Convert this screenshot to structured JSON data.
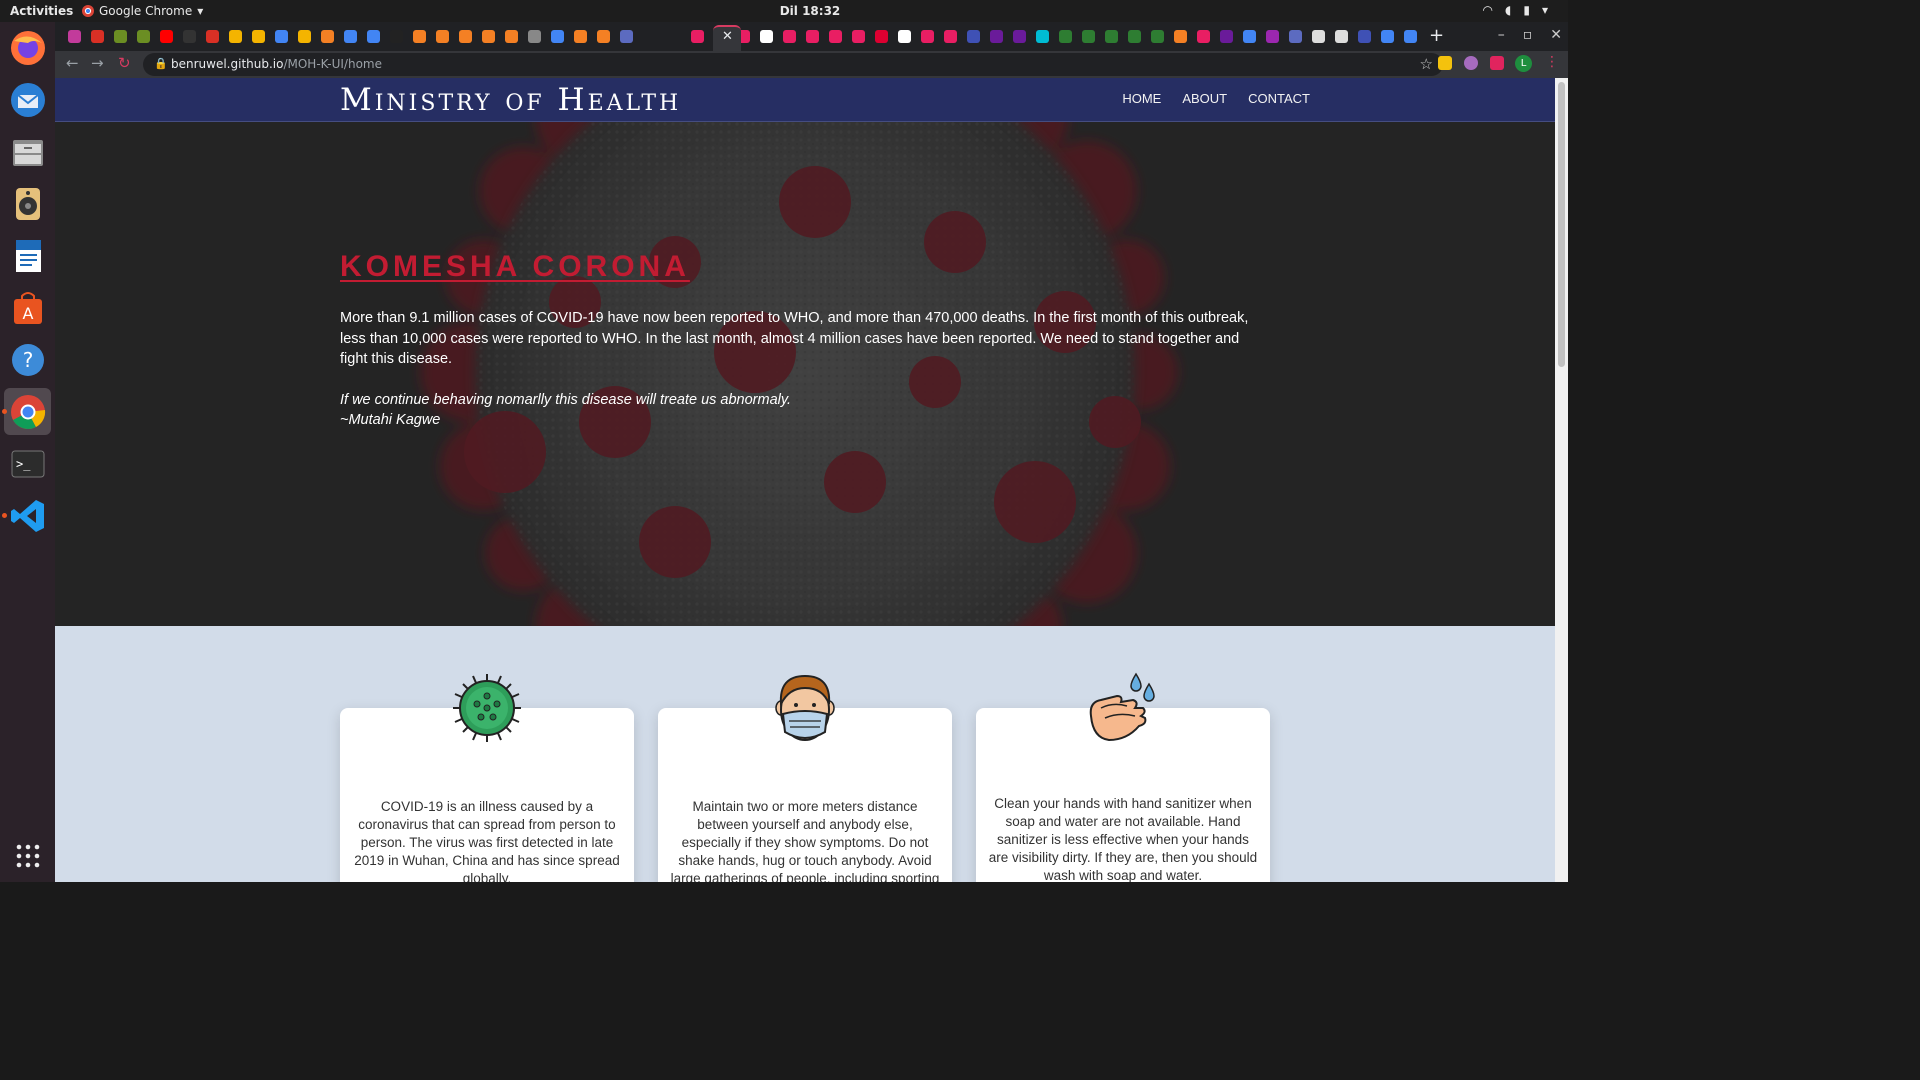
{
  "os": {
    "activities": "Activities",
    "app_name": "Google Chrome",
    "clock": "Dil 18:32"
  },
  "browser": {
    "url_host": "benruwel.github.io",
    "url_path": "/MOH-K-UI/home",
    "profile_initial": "L"
  },
  "site": {
    "brand": "Ministry of Health",
    "nav": [
      "HOME",
      "ABOUT",
      "CONTACT"
    ],
    "hero": {
      "title": "KOMESHA CORONA",
      "text": "More than 9.1 million cases of COVID-19 have now been reported to WHO, and more than 470,000 deaths. In the first month of this outbreak, less than 10,000 cases were reported to WHO. In the last month, almost 4 million cases have been reported. We need to stand together and fight this disease.",
      "quote": "If we continue behaving nomarlly this disease will treate us abnormaly.",
      "quote_author": "~Mutahi Kagwe"
    },
    "cards": [
      {
        "icon": "virus-icon",
        "text": "COVID-19 is an illness caused by a coronavirus that can spread from person to person. The virus was first detected in late 2019 in Wuhan, China and has since spread globally."
      },
      {
        "icon": "face-mask-icon",
        "text": "Maintain two or more meters distance between yourself and anybody else, especially if they show symptoms. Do not shake hands, hug or touch anybody. Avoid large gatherings of people, including sporting"
      },
      {
        "icon": "hand-washing-icon",
        "text": "Clean your hands with hand sanitizer when soap and water are not available. Hand sanitizer is less effective when your hands are visibility dirty. If they are, then you should wash with soap and water."
      }
    ]
  },
  "colors": {
    "navbar": "#262e63",
    "hero_title": "#c21c32",
    "section_bg": "#d2dce9"
  }
}
